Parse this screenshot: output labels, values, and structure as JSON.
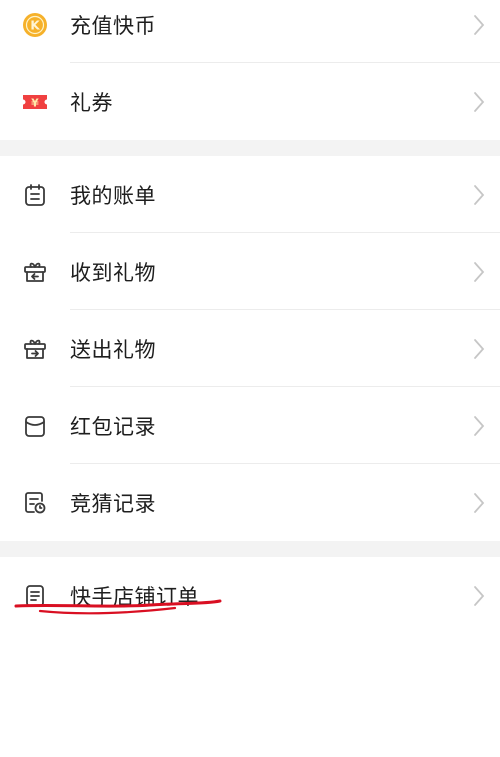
{
  "group1": [
    {
      "label": "充值快币",
      "icon": "kuaibi-coin-icon",
      "icon_text": "K"
    },
    {
      "label": "礼券",
      "icon": "coupon-ticket-icon",
      "icon_text": "¥"
    }
  ],
  "group2": [
    {
      "label": "我的账单",
      "icon": "bill-icon"
    },
    {
      "label": "收到礼物",
      "icon": "gift-received-icon"
    },
    {
      "label": "送出礼物",
      "icon": "gift-sent-icon"
    },
    {
      "label": "红包记录",
      "icon": "red-envelope-icon"
    },
    {
      "label": "竞猜记录",
      "icon": "guess-record-icon"
    }
  ],
  "group3": [
    {
      "label": "快手店铺订单",
      "icon": "shop-order-icon"
    }
  ],
  "colors": {
    "coin": "#f6b12a",
    "coupon": "#f04040",
    "annotation": "#d90f22"
  }
}
